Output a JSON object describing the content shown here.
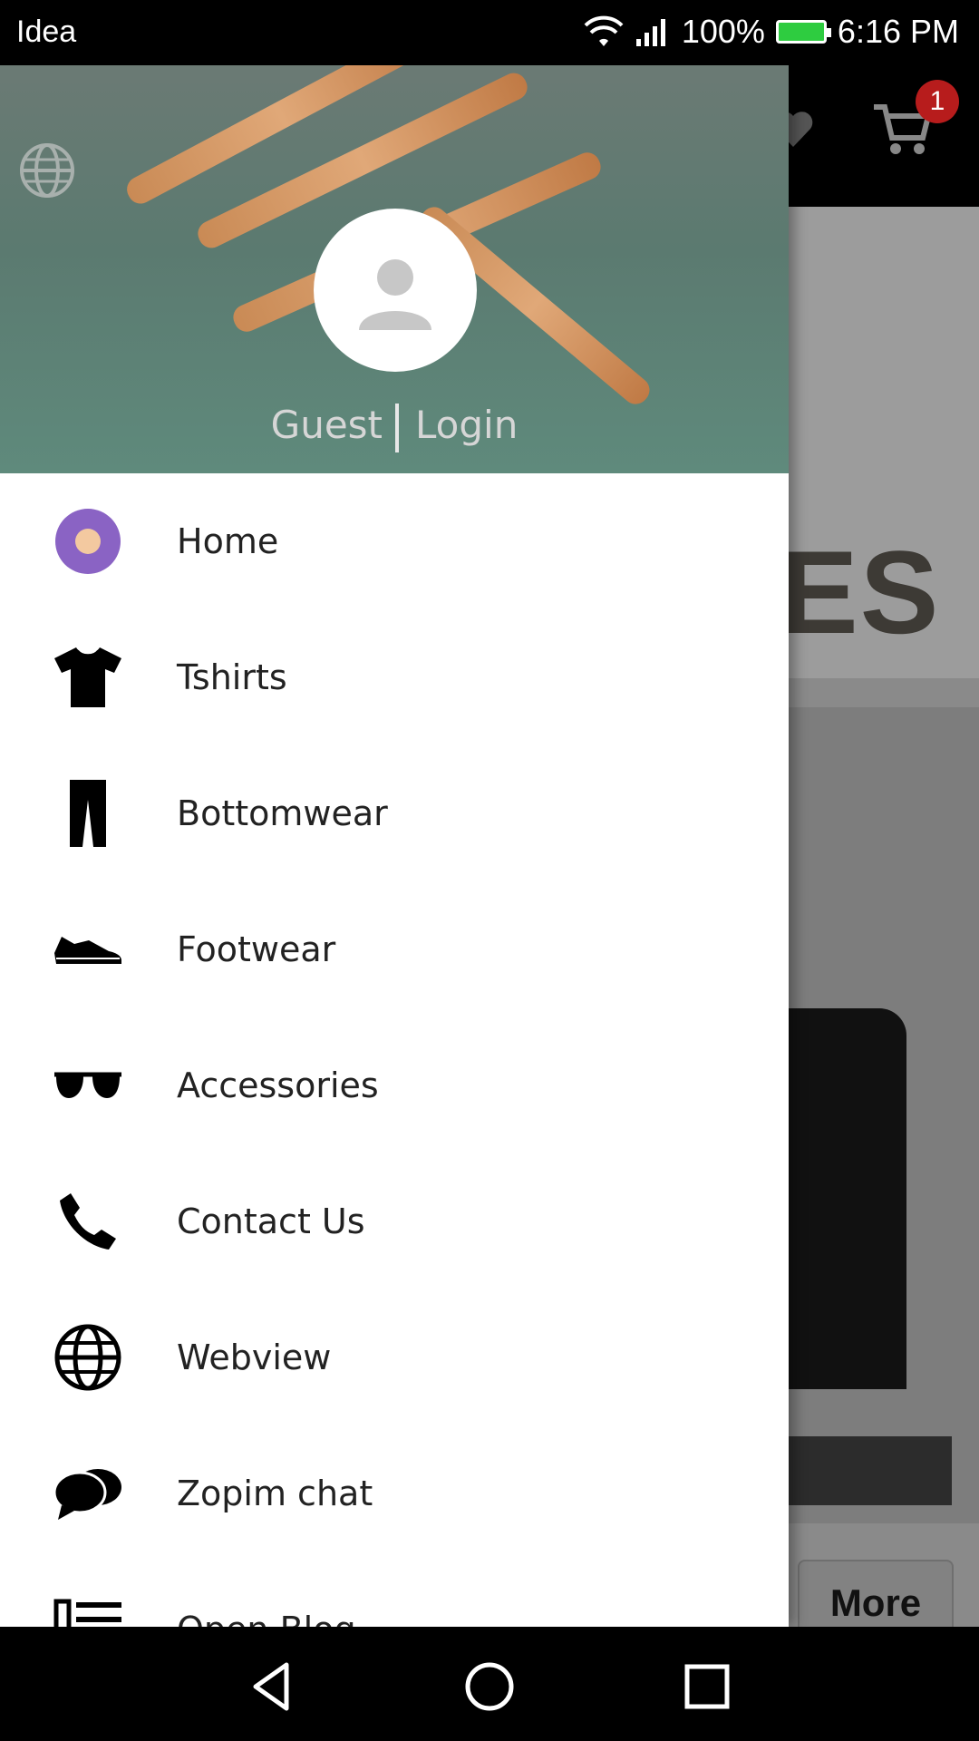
{
  "status_bar": {
    "carrier": "Idea",
    "battery": "100%",
    "time": "6:16 PM"
  },
  "background_app": {
    "cart_badge": "1",
    "banner_text": "ES",
    "more_label": "More"
  },
  "drawer": {
    "header": {
      "guest_label": "Guest",
      "login_label": "Login"
    },
    "items": [
      {
        "label": "Home",
        "icon": "home-icon"
      },
      {
        "label": "Tshirts",
        "icon": "tshirt-icon"
      },
      {
        "label": "Bottomwear",
        "icon": "pants-icon"
      },
      {
        "label": "Footwear",
        "icon": "shoe-icon"
      },
      {
        "label": "Accessories",
        "icon": "sunglasses-icon"
      },
      {
        "label": "Contact Us",
        "icon": "phone-icon"
      },
      {
        "label": "Webview",
        "icon": "globe-icon"
      },
      {
        "label": "Zopim chat",
        "icon": "chat-icon"
      },
      {
        "label": "Open Blog",
        "icon": "blog-icon"
      }
    ]
  },
  "colors": {
    "home_icon_ring": "#8a63c4",
    "home_icon_center": "#f3c9a0",
    "cart_badge": "#b71c1c"
  }
}
